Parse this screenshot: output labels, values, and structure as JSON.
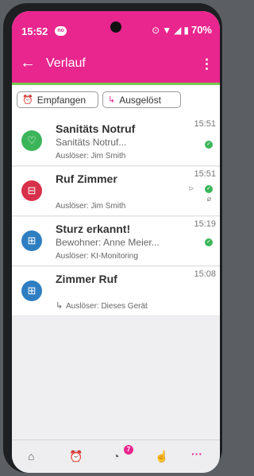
{
  "status": {
    "time": "15:52",
    "notif_badge": "no",
    "battery": "70%"
  },
  "appbar": {
    "title": "Verlauf",
    "back_icon": "arrow-left-icon",
    "menu_icon": "more-vert-icon"
  },
  "filters": [
    {
      "label": "Empfangen",
      "icon": "alarm-icon"
    },
    {
      "label": "Ausgelöst",
      "icon": "arrow-turn-icon"
    }
  ],
  "entries": [
    {
      "title": "Sanitäts Notruf",
      "subtitle": "Sanitäts Notruf...",
      "trigger": "Auslöser: Jim Smith",
      "time": "15:51",
      "color": "#3cb55a",
      "icon": "heart-icon"
    },
    {
      "title": "Ruf Zimmer",
      "subtitle": "",
      "trigger": "Auslöser: Jim Smith",
      "time": "15:51",
      "color": "#d8314a",
      "icon": "bed-icon"
    },
    {
      "title": "Sturz erkannt!",
      "subtitle": "Bewohner: Anne Meier...",
      "trigger": "Auslöser: KI-Monitoring",
      "time": "15:19",
      "color": "#2f7ec2",
      "icon": "medkit-icon"
    },
    {
      "title": "Zimmer Ruf",
      "subtitle": "",
      "trigger": "Auslöser: Dieses Gerät",
      "time": "15:08",
      "color": "#2f7ec2",
      "icon": "medkit-icon"
    }
  ],
  "nav": {
    "badge": "7",
    "more": "···"
  },
  "colors": {
    "brand": "#e8268e",
    "accent": "#77c94f"
  }
}
